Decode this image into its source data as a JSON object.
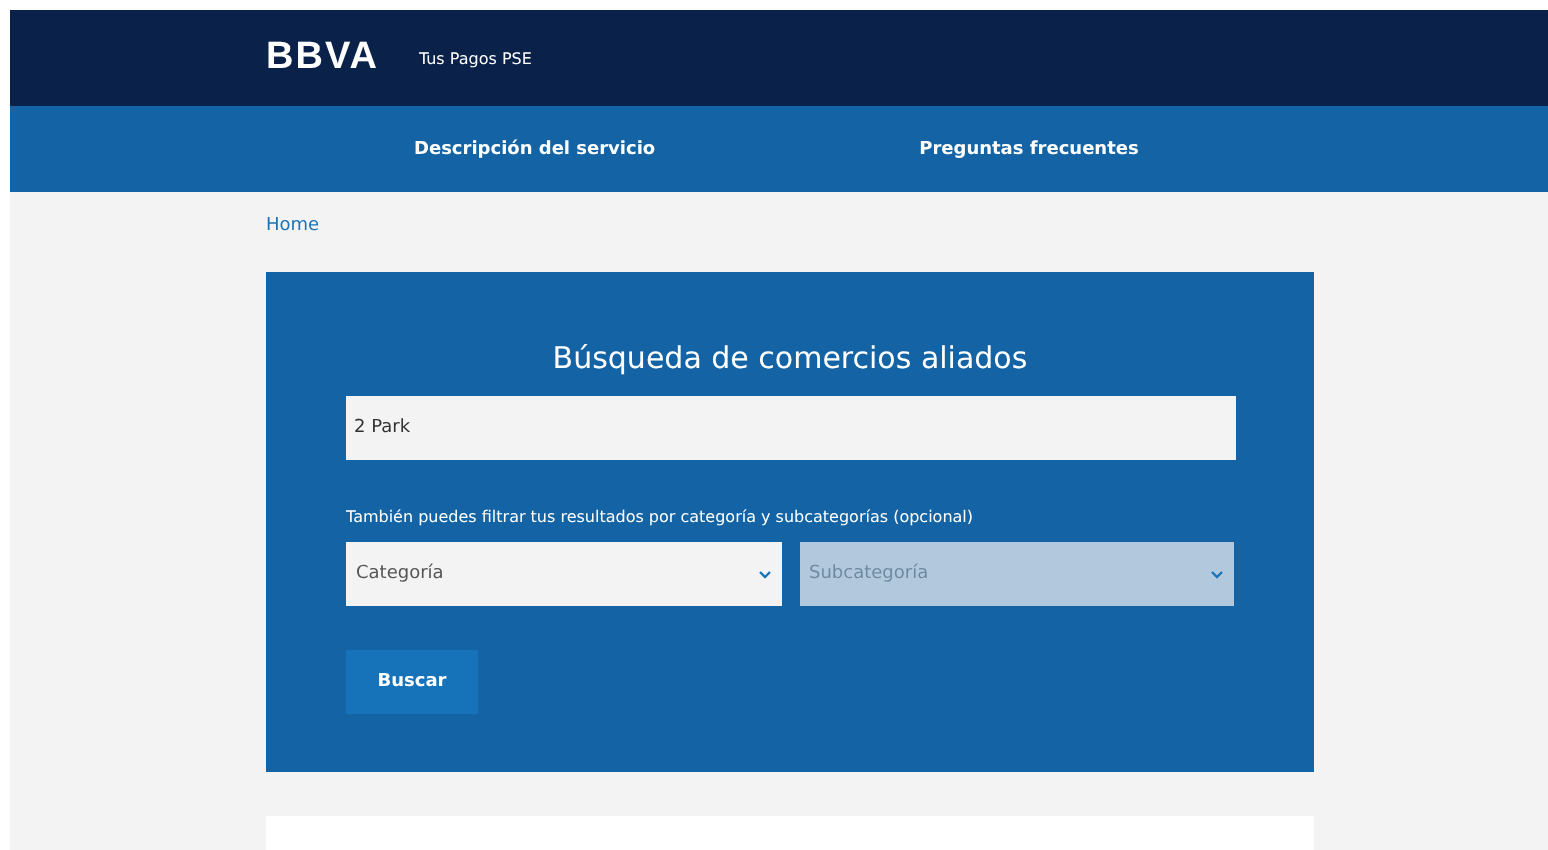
{
  "header": {
    "logo": "BBVA",
    "subtitle": "Tus Pagos PSE"
  },
  "nav": [
    {
      "label": "Descripción del servicio"
    },
    {
      "label": "Preguntas frecuentes"
    }
  ],
  "breadcrumb": "Home",
  "search_card": {
    "title": "Búsqueda de comercios aliados",
    "query": {
      "value": "2 Park"
    },
    "filter_hint": "También puedes filtrar tus resultados por categoría y subcategorías (opcional)",
    "selects": [
      {
        "placeholder": "Categoría",
        "disabled": false
      },
      {
        "placeholder": "Subcategoría",
        "disabled": true
      }
    ],
    "button": "Buscar"
  }
}
